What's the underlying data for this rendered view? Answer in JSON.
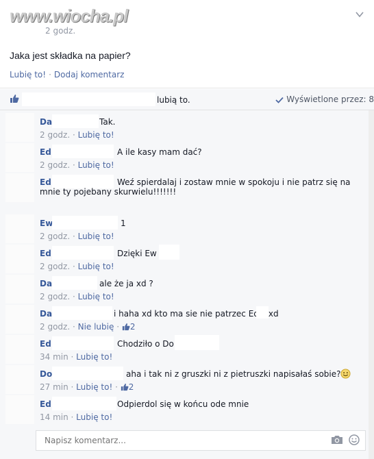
{
  "watermark": "www.wiocha.pl",
  "post": {
    "time": "2 godz.",
    "text": "Jaka jest składka na papier?",
    "actions": {
      "like": "Lubię to!",
      "comment": "Dodaj komentarz"
    }
  },
  "likes_bar": {
    "likes_text": "lubią to.",
    "seen_text": "Wyświetlone przez: 8"
  },
  "comments": [
    {
      "name": "Da",
      "text": "Tak.",
      "time": "2 godz.",
      "like": "Lubię to!"
    },
    {
      "name": "Ed",
      "text": "A ile kasy mam dać?",
      "time": "2 godz.",
      "like": "Lubię to!"
    },
    {
      "name": "Ed",
      "text": "Weź spierdalaj i zostaw mnie w spokoju i nie patrz się na mnie ty pojebany skurwielu!!!!!!!",
      "time": "",
      "like": ""
    },
    {
      "name": "Ew",
      "text": "1",
      "time": "2 godz.",
      "like": "Lubię to!"
    },
    {
      "name": "Ed",
      "text": "Dzięki Ew",
      "time": "2 godz.",
      "like": "Lubię to!"
    },
    {
      "name": "Da",
      "text": "ale że ja xd ?",
      "time": "2 godz.",
      "like": "Lubię to!"
    },
    {
      "name": "Da",
      "text": "i haha xd kto ma sie nie patrzec Ed      ? xd",
      "time": "2 godz.",
      "like": "Nie lubię",
      "likes": "2"
    },
    {
      "name": "Ed",
      "text": "Chodziło o Do",
      "time": "34 min",
      "like": "Lubię to!"
    },
    {
      "name": "Do",
      "text": "aha i tak ni z gruszki ni z pietruszki napisałaś sobie?",
      "time": "27 min",
      "like": "Lubię to!",
      "likes": "2"
    },
    {
      "name": "Ed",
      "text": "Odpierdol się w końcu ode mnie",
      "time": "14 min",
      "like": "Lubię to!"
    }
  ],
  "composer": {
    "placeholder": "Napisz komentarz..."
  },
  "colors": {
    "link": "#4e69a2",
    "name": "#365899",
    "muted": "#9197a3",
    "bar_bg": "#f6f7f9"
  }
}
